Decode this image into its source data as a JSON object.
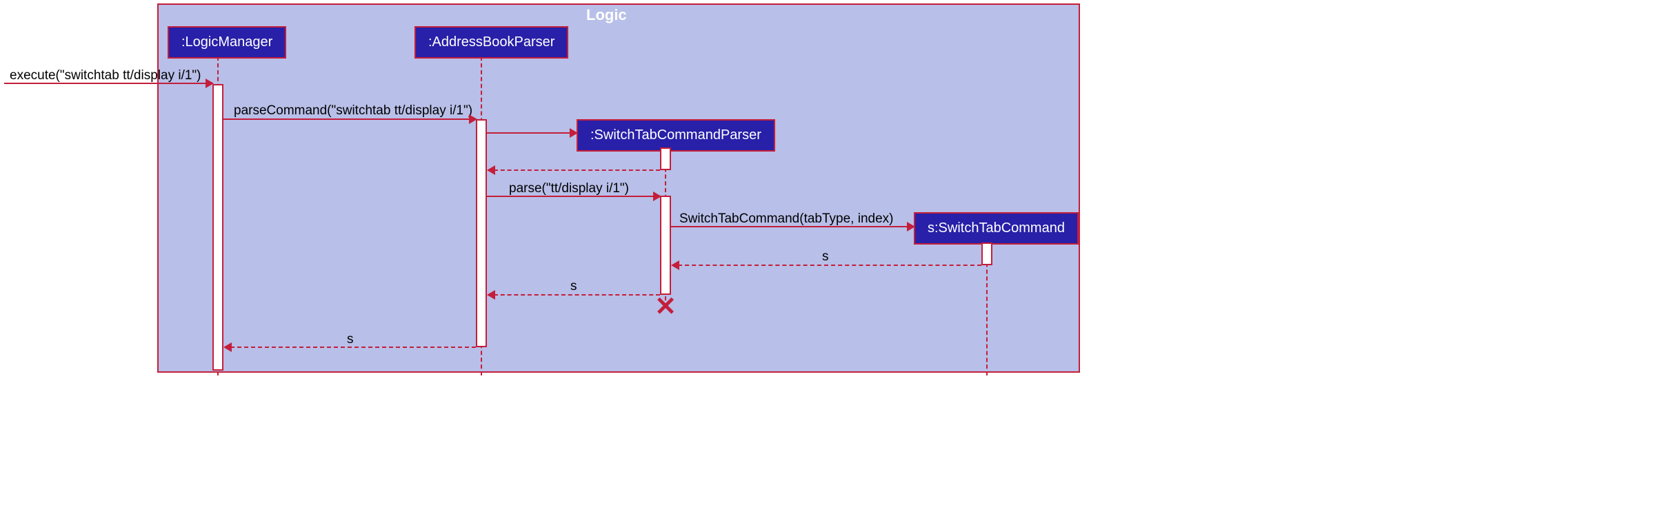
{
  "frame": {
    "title": "Logic"
  },
  "participants": {
    "logicManager": ":LogicManager",
    "addressBookParser": ":AddressBookParser",
    "switchTabCommandParser": ":SwitchTabCommandParser",
    "switchTabCommand": "s:SwitchTabCommand"
  },
  "messages": {
    "execute": "execute(\"switchtab tt/display i/1\")",
    "parseCommand": "parseCommand(\"switchtab tt/display i/1\")",
    "parse": "parse(\"tt/display i/1\")",
    "switchTabCommand": "SwitchTabCommand(tabType, index)",
    "return_s1": "s",
    "return_s2": "s",
    "return_s3": "s"
  }
}
